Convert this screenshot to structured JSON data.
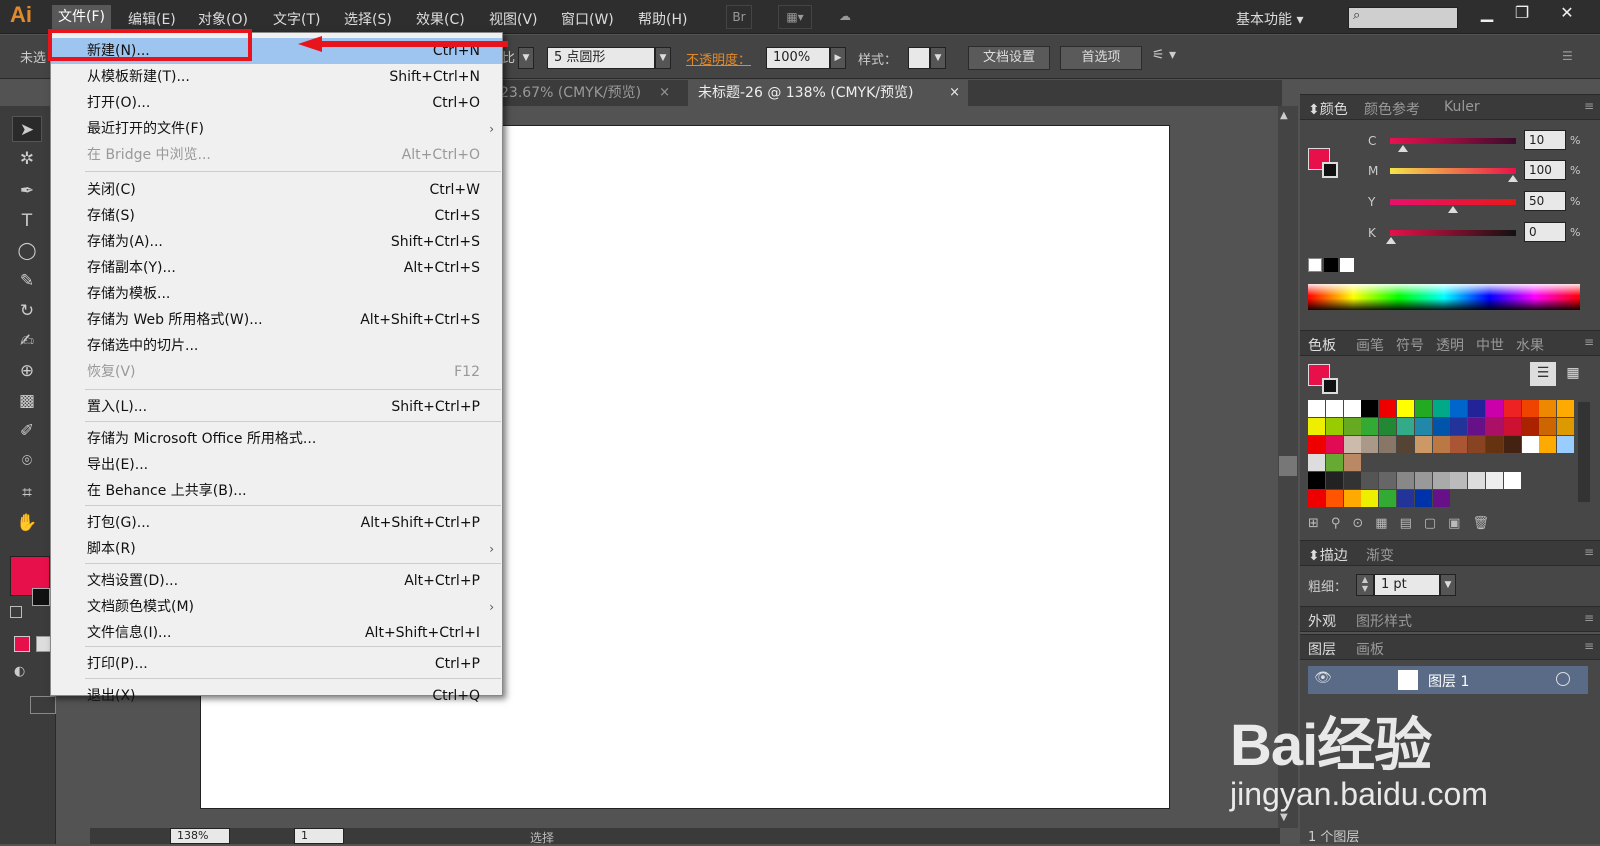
{
  "app": {
    "logo": "Ai",
    "workspace": "基本功能"
  },
  "menubar": [
    "文件(F)",
    "编辑(E)",
    "对象(O)",
    "文字(T)",
    "选择(S)",
    "效果(C)",
    "视图(V)",
    "窗口(W)",
    "帮助(H)"
  ],
  "topicons": {
    "bridge": "Br"
  },
  "control": {
    "status": "未选",
    "stroke_style": "5 点圆形",
    "opacity_label": "不透明度：",
    "opacity": "100%",
    "style_label": "样式：",
    "doc_setup": "文档设置",
    "prefs": "首选项",
    "partial_left": "比"
  },
  "tabs": [
    {
      "label": "23.67% (CMYK/预览)",
      "close": "×"
    },
    {
      "label": "未标题-26 @ 138% (CMYK/预览)",
      "close": "×"
    }
  ],
  "status": {
    "zoom": "138%",
    "page": "1",
    "tool": "选择"
  },
  "color_panel": {
    "tabs": [
      "颜色",
      "颜色参考",
      "Kuler"
    ],
    "channels": [
      {
        "label": "C",
        "value": "10",
        "pct": "%"
      },
      {
        "label": "M",
        "value": "100",
        "pct": "%"
      },
      {
        "label": "Y",
        "value": "50",
        "pct": "%"
      },
      {
        "label": "K",
        "value": "0",
        "pct": "%"
      }
    ],
    "fill_color": "#e8104a"
  },
  "swatch_panel": {
    "tabs": [
      "色板",
      "画笔",
      "符号",
      "透明",
      "中世",
      "水果"
    ]
  },
  "stroke_panel": {
    "tabs": [
      "描边",
      "渐变"
    ],
    "weight_label": "粗细：",
    "weight": "1 pt"
  },
  "appearance_panel": {
    "tabs": [
      "外观",
      "图形样式"
    ]
  },
  "layers_panel": {
    "tabs": [
      "图层",
      "画板"
    ],
    "layer_name": "图层 1",
    "footer": "1 个图层"
  },
  "file_menu": {
    "items": [
      {
        "label": "新建(N)...",
        "shortcut": "Ctrl+N",
        "highlight": true
      },
      {
        "label": "从模板新建(T)...",
        "shortcut": "Shift+Ctrl+N"
      },
      {
        "label": "打开(O)...",
        "shortcut": "Ctrl+O"
      },
      {
        "label": "最近打开的文件(F)",
        "shortcut": "",
        "submenu": "›"
      },
      {
        "label": "在 Bridge 中浏览...",
        "shortcut": "Alt+Ctrl+O",
        "disabled": true
      },
      {
        "label": "关闭(C)",
        "shortcut": "Ctrl+W"
      },
      {
        "label": "存储(S)",
        "shortcut": "Ctrl+S"
      },
      {
        "label": "存储为(A)...",
        "shortcut": "Shift+Ctrl+S"
      },
      {
        "label": "存储副本(Y)...",
        "shortcut": "Alt+Ctrl+S"
      },
      {
        "label": "存储为模板...",
        "shortcut": ""
      },
      {
        "label": "存储为 Web 所用格式(W)...",
        "shortcut": "Alt+Shift+Ctrl+S"
      },
      {
        "label": "存储选中的切片...",
        "shortcut": ""
      },
      {
        "label": "恢复(V)",
        "shortcut": "F12",
        "disabled": true
      },
      {
        "label": "置入(L)...",
        "shortcut": "Shift+Ctrl+P"
      },
      {
        "label": "存储为 Microsoft Office 所用格式...",
        "shortcut": ""
      },
      {
        "label": "导出(E)...",
        "shortcut": ""
      },
      {
        "label": "在 Behance 上共享(B)...",
        "shortcut": ""
      },
      {
        "label": "打包(G)...",
        "shortcut": "Alt+Shift+Ctrl+P"
      },
      {
        "label": "脚本(R)",
        "shortcut": "",
        "submenu": "›"
      },
      {
        "label": "文档设置(D)...",
        "shortcut": "Alt+Ctrl+P"
      },
      {
        "label": "文档颜色模式(M)",
        "shortcut": "",
        "submenu": "›"
      },
      {
        "label": "文件信息(I)...",
        "shortcut": "Alt+Shift+Ctrl+I"
      },
      {
        "label": "打印(P)...",
        "shortcut": "Ctrl+P"
      },
      {
        "label": "退出(X)",
        "shortcut": "Ctrl+Q"
      }
    ]
  },
  "watermark": {
    "brand": "Bai经验",
    "url": "jingyan.baidu.com"
  },
  "annotation": {
    "color": "#e8131b"
  }
}
